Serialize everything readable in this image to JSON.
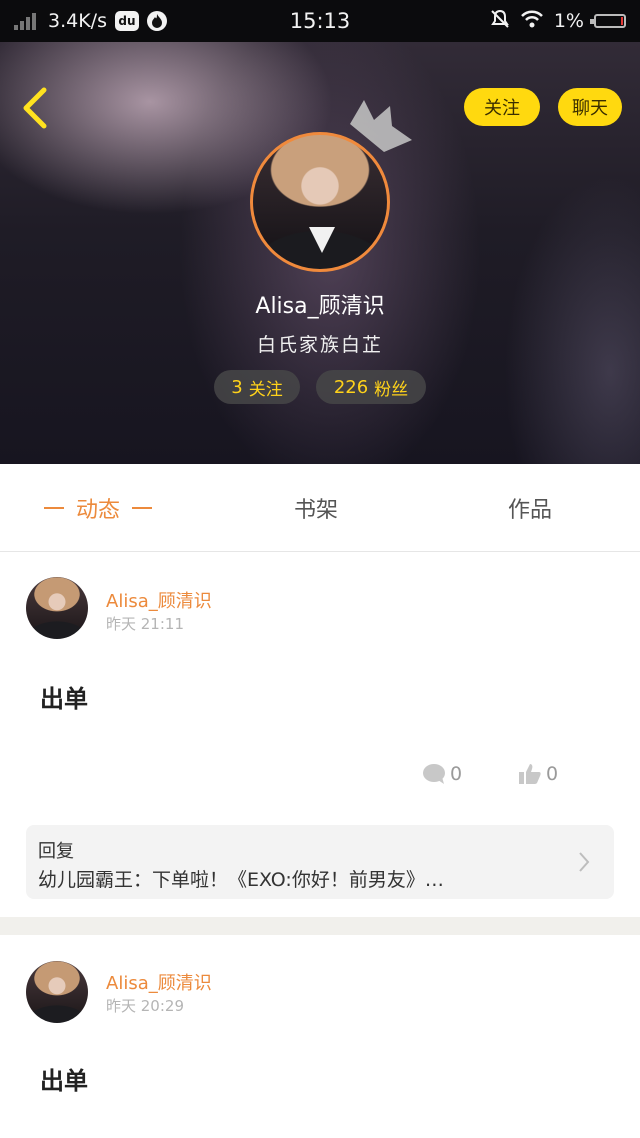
{
  "status_bar": {
    "network_speed": "3.4K/s",
    "du_label": "du",
    "time": "15:13",
    "battery": "1%",
    "battery_level": 0.01
  },
  "header": {
    "follow_label": "关注",
    "chat_label": "聊天",
    "name": "Alisa_顾清识",
    "title": "白氏家族白芷",
    "following_count": "3",
    "following_label": "关注",
    "fans_count": "226",
    "fans_label": "粉丝"
  },
  "tabs": [
    {
      "label": "动态",
      "active": true
    },
    {
      "label": "书架",
      "active": false
    },
    {
      "label": "作品",
      "active": false
    }
  ],
  "posts": [
    {
      "author": "Alisa_顾清识",
      "time": "昨天 21:11",
      "text": "出单",
      "comments": "0",
      "likes": "0",
      "reply_label": "回复",
      "reply_text": "幼儿园霸王：下单啦！《EXO:你好！前男友》…"
    },
    {
      "author": "Alisa_顾清识",
      "time": "昨天 20:29",
      "text": "出单"
    }
  ],
  "colors": {
    "accent_orange": "#ec8a3c",
    "button_yellow": "#ffd90f",
    "stat_yellow": "#ffd21a"
  },
  "icons": [
    "signal-icon",
    "du-app-icon",
    "flame-app-icon",
    "mute-icon",
    "wifi-icon",
    "battery-icon",
    "back-arrow-icon",
    "crown-icon",
    "comment-icon",
    "like-icon",
    "chevron-right-icon"
  ]
}
